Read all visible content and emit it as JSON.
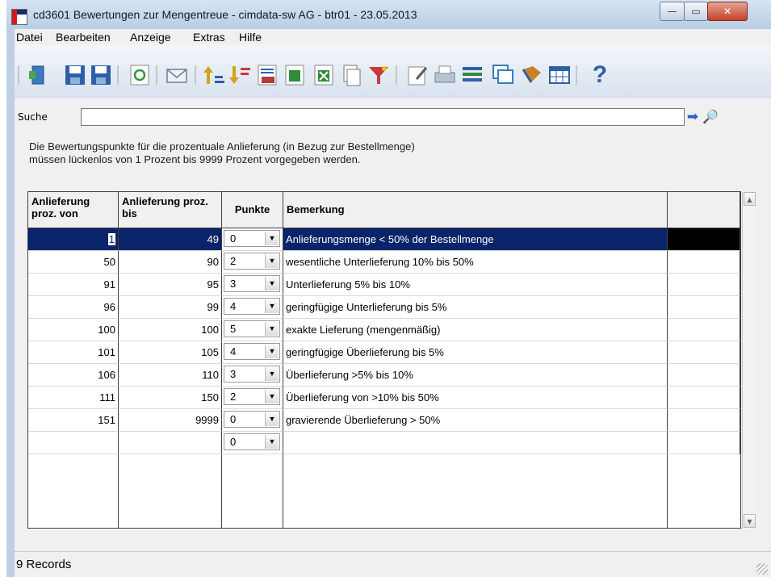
{
  "window": {
    "title": "cd3601 Bewertungen zur Mengentreue - cimdata-sw AG - btr01 - 23.05.2013",
    "buttons": {
      "minimize": "—",
      "maximize": "▭",
      "close": "✕"
    }
  },
  "menu": {
    "items": [
      {
        "label": "Datei"
      },
      {
        "label": "Bearbeiten"
      },
      {
        "label": "Anzeige"
      },
      {
        "label": "Extras"
      },
      {
        "label": "Hilfe"
      }
    ]
  },
  "toolbar": {
    "icons": [
      {
        "name": "exit-door-icon",
        "color": "#3a7bbf"
      },
      {
        "name": "save-icon",
        "color": "#2f5fa8"
      },
      {
        "name": "save-all-icon",
        "color": "#2f5fa8"
      },
      {
        "name": "refresh-icon",
        "color": "#2f9a3c"
      },
      {
        "name": "mail-icon",
        "color": "#8a9bb3"
      },
      {
        "name": "sort-ascending-icon",
        "color": "#d3a21c"
      },
      {
        "name": "sort-descending-icon",
        "color": "#d3a21c"
      },
      {
        "name": "numbered-list-icon",
        "color": "#b33a3a"
      },
      {
        "name": "export-icon",
        "color": "#2f8a3a"
      },
      {
        "name": "excel-icon",
        "color": "#2f8a3a"
      },
      {
        "name": "copy-document-icon",
        "color": "#8a9bb3"
      },
      {
        "name": "filter-icon",
        "color": "#c93a3a"
      },
      {
        "name": "edit-properties-icon",
        "color": "#8a9bb3"
      },
      {
        "name": "print-icon",
        "color": "#6a7f9e"
      },
      {
        "name": "list-icon",
        "color": "#2f5fa8"
      },
      {
        "name": "windows-icon",
        "color": "#3a7bbf"
      },
      {
        "name": "bookmark-icon",
        "color": "#c9822a"
      },
      {
        "name": "table-view-icon",
        "color": "#2f5fa8"
      },
      {
        "name": "help-icon",
        "color": "#2f5fa8"
      }
    ],
    "help_glyph": "?"
  },
  "search": {
    "label": "Suche",
    "value": "",
    "go_glyph": "➡",
    "find_glyph": "🔎"
  },
  "info": {
    "line1": "Die Bewertungspunkte für die prozentuale Anlieferung (in Bezug zur Bestellmenge)",
    "line2": "müssen lückenlos von 1 Prozent bis 9999 Prozent vorgegeben werden."
  },
  "grid": {
    "columns": {
      "von": "Anlieferung proz. von",
      "bis": "Anlieferung proz. bis",
      "punkte": "Punkte",
      "bemerkung": "Bemerkung"
    },
    "rows": [
      {
        "von": "1",
        "bis": "49",
        "punkte": "0",
        "bemerkung": "Anlieferungsmenge < 50% der Bestellmenge",
        "selected": true
      },
      {
        "von": "50",
        "bis": "90",
        "punkte": "2",
        "bemerkung": "wesentliche Unterlieferung  10% bis 50%"
      },
      {
        "von": "91",
        "bis": "95",
        "punkte": "3",
        "bemerkung": "Unterlieferung  5% bis 10%"
      },
      {
        "von": "96",
        "bis": "99",
        "punkte": "4",
        "bemerkung": "geringfügige Unterlieferung  bis  5%"
      },
      {
        "von": "100",
        "bis": "100",
        "punkte": "5",
        "bemerkung": "exakte Lieferung (mengenmäßig)"
      },
      {
        "von": "101",
        "bis": "105",
        "punkte": "4",
        "bemerkung": "geringfügige Überlieferung bis 5%"
      },
      {
        "von": "106",
        "bis": "110",
        "punkte": "3",
        "bemerkung": "Überlieferung  >5%  bis 10%"
      },
      {
        "von": "111",
        "bis": "150",
        "punkte": "2",
        "bemerkung": "Überlieferung von >10%  bis 50%"
      },
      {
        "von": "151",
        "bis": "9999",
        "punkte": "0",
        "bemerkung": "gravierende Überlieferung  > 50%"
      },
      {
        "von": "",
        "bis": "",
        "punkte": "0",
        "bemerkung": ""
      }
    ]
  },
  "status": {
    "records": "9 Records"
  }
}
